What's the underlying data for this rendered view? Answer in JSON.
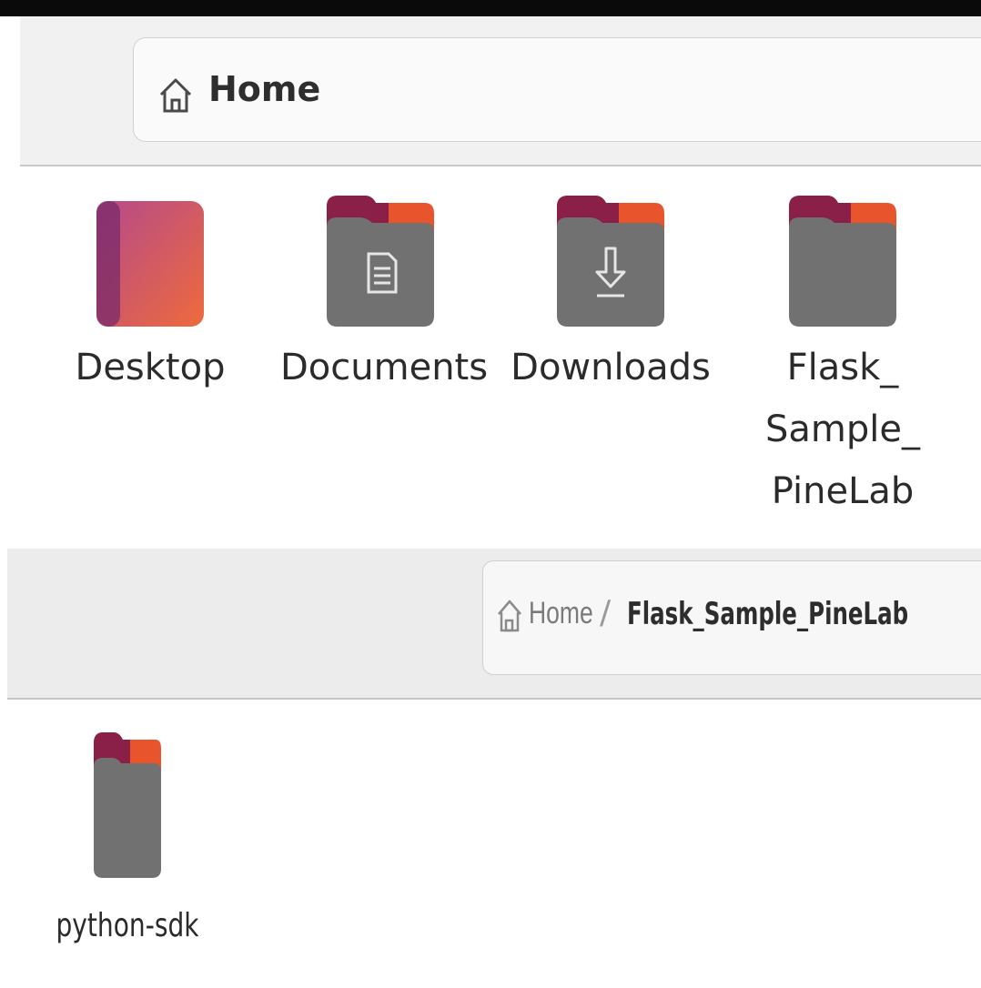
{
  "window1": {
    "path": {
      "home_label": "Home"
    },
    "items": [
      {
        "name": "Desktop",
        "icon": "desktop-folder-icon"
      },
      {
        "name": "Documents",
        "icon": "documents-folder-icon"
      },
      {
        "name": "Downloads",
        "icon": "downloads-folder-icon"
      },
      {
        "name_lines": [
          "Flask_",
          "Sample_",
          "PineLab"
        ],
        "icon": "folder-icon"
      }
    ]
  },
  "window2": {
    "path": {
      "home_label": "Home",
      "separator": "/",
      "current": "Flask_Sample_PineLab"
    },
    "items": [
      {
        "name": "python-sdk",
        "icon": "folder-icon"
      }
    ]
  },
  "colors": {
    "folder_body": "#717171",
    "folder_tab_left": "#8a2048",
    "folder_tab_right": "#e8542b",
    "desktop_gradient_start": "#b44a8c",
    "desktop_gradient_end": "#ee6a3c"
  }
}
